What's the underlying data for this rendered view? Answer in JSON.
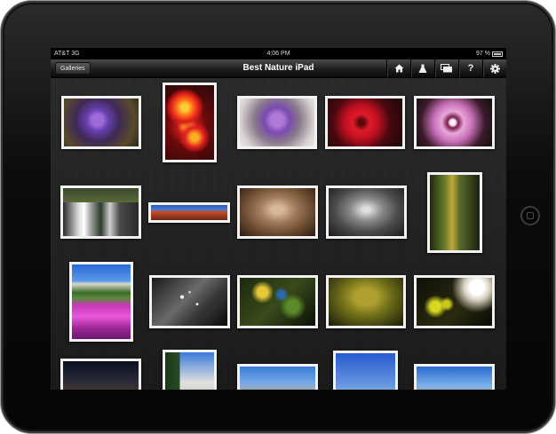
{
  "statusbar": {
    "carrier": "AT&T 3G",
    "time": "4:06 PM",
    "battery": "97 %"
  },
  "toolbar": {
    "back_label": "Galleries",
    "title": "Best Nature iPad",
    "icons": [
      "home-icon",
      "flask-icon",
      "slideshow-icon",
      "help-icon",
      "gear-icon"
    ],
    "help_glyph": "?"
  },
  "colors": {
    "bezel": "#0c0c0c",
    "background": "#1d1d1d",
    "toolbar": "#1e1e1e",
    "photo_border": "#f2f2f2"
  },
  "gallery": {
    "photos": [
      {
        "name": "purple-lilac"
      },
      {
        "name": "lantana-flowers"
      },
      {
        "name": "purple-thistle"
      },
      {
        "name": "red-flower"
      },
      {
        "name": "pink-flower"
      },
      {
        "name": "waterfall"
      },
      {
        "name": "red-canyon-panorama"
      },
      {
        "name": "dried-grass"
      },
      {
        "name": "dried-grass-bw"
      },
      {
        "name": "autumn-forest"
      },
      {
        "name": "yosemite-flowers"
      },
      {
        "name": "water-drops-leaf"
      },
      {
        "name": "green-leaves"
      },
      {
        "name": "moss"
      },
      {
        "name": "bokeh-buds"
      },
      {
        "name": "night-sky"
      },
      {
        "name": "half-dome"
      },
      {
        "name": "yosemite-valley"
      },
      {
        "name": "el-capitan"
      },
      {
        "name": "valley-view"
      }
    ]
  }
}
